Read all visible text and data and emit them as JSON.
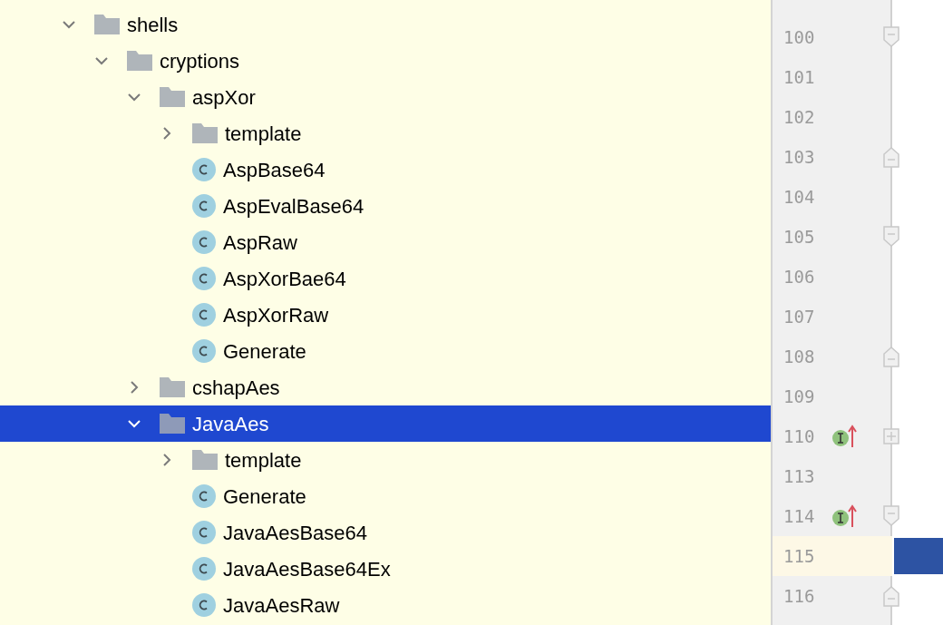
{
  "tree": [
    {
      "kind": "folder",
      "label": "shells",
      "expanded": true,
      "selected": false,
      "children": [
        {
          "kind": "folder",
          "label": "cryptions",
          "expanded": true,
          "selected": false,
          "children": [
            {
              "kind": "folder",
              "label": "aspXor",
              "expanded": true,
              "selected": false,
              "children": [
                {
                  "kind": "folder",
                  "label": "template",
                  "expanded": false,
                  "selected": false
                },
                {
                  "kind": "class",
                  "label": "AspBase64",
                  "selected": false
                },
                {
                  "kind": "class",
                  "label": "AspEvalBase64",
                  "selected": false
                },
                {
                  "kind": "class",
                  "label": "AspRaw",
                  "selected": false
                },
                {
                  "kind": "class",
                  "label": "AspXorBae64",
                  "selected": false
                },
                {
                  "kind": "class",
                  "label": "AspXorRaw",
                  "selected": false
                },
                {
                  "kind": "class",
                  "label": "Generate",
                  "selected": false
                }
              ]
            },
            {
              "kind": "folder",
              "label": "cshapAes",
              "expanded": false,
              "selected": false
            },
            {
              "kind": "folder",
              "label": "JavaAes",
              "expanded": true,
              "selected": true,
              "children": [
                {
                  "kind": "folder",
                  "label": "template",
                  "expanded": false,
                  "selected": false
                },
                {
                  "kind": "class",
                  "label": "Generate",
                  "selected": false
                },
                {
                  "kind": "class",
                  "label": "JavaAesBase64",
                  "selected": false
                },
                {
                  "kind": "class",
                  "label": "JavaAesBase64Ex",
                  "selected": false
                },
                {
                  "kind": "class",
                  "label": "JavaAesRaw",
                  "selected": false
                }
              ]
            }
          ]
        }
      ]
    }
  ],
  "gutter": {
    "lines": [
      {
        "number": "100",
        "fold_marker": {
          "kind": "start"
        },
        "implements": false,
        "current": false
      },
      {
        "number": "101",
        "implements": false,
        "current": false
      },
      {
        "number": "102",
        "implements": false,
        "current": false
      },
      {
        "number": "103",
        "fold_marker": {
          "kind": "end"
        },
        "implements": false,
        "current": false
      },
      {
        "number": "104",
        "implements": false,
        "current": false
      },
      {
        "number": "105",
        "fold_marker": {
          "kind": "start"
        },
        "implements": false,
        "current": false
      },
      {
        "number": "106",
        "implements": false,
        "current": false
      },
      {
        "number": "107",
        "implements": false,
        "current": false
      },
      {
        "number": "108",
        "fold_marker": {
          "kind": "end"
        },
        "implements": false,
        "current": false
      },
      {
        "number": "109",
        "implements": false,
        "current": false
      },
      {
        "number": "110",
        "fold_marker": {
          "kind": "collapsed"
        },
        "implements": true,
        "current": false
      },
      {
        "number": "113",
        "implements": false,
        "current": false
      },
      {
        "number": "114",
        "fold_marker": {
          "kind": "start"
        },
        "implements": true,
        "current": false
      },
      {
        "number": "115",
        "implements": false,
        "current": true
      },
      {
        "number": "116",
        "fold_marker": {
          "kind": "end"
        },
        "implements": false,
        "current": false
      }
    ]
  }
}
